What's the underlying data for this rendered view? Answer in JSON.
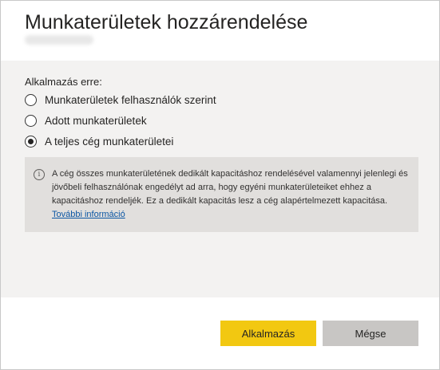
{
  "dialog": {
    "title": "Munkaterületek hozzárendelése"
  },
  "apply_to": {
    "label": "Alkalmazás erre:",
    "options": [
      {
        "label": "Munkaterületek felhasználók szerint",
        "selected": false
      },
      {
        "label": "Adott munkaterületek",
        "selected": false
      },
      {
        "label": "A teljes cég munkaterületei",
        "selected": true
      }
    ]
  },
  "info": {
    "icon": "info-icon",
    "text": "A cég összes munkaterületének dedikált kapacitáshoz rendelésével valamennyi jelenlegi és jövőbeli felhasználónak engedélyt ad arra, hogy egyéni munkaterületeiket ehhez a kapacitáshoz rendeljék. Ez a dedikált kapacitás lesz a cég alapértelmezett kapacitása. ",
    "link": "További információ"
  },
  "buttons": {
    "apply": "Alkalmazás",
    "cancel": "Mégse"
  },
  "colors": {
    "primary": "#f2c811",
    "secondary": "#c8c6c4",
    "panel": "#f3f2f1",
    "info_box": "#e1dfdd",
    "link": "#0b56a4"
  }
}
